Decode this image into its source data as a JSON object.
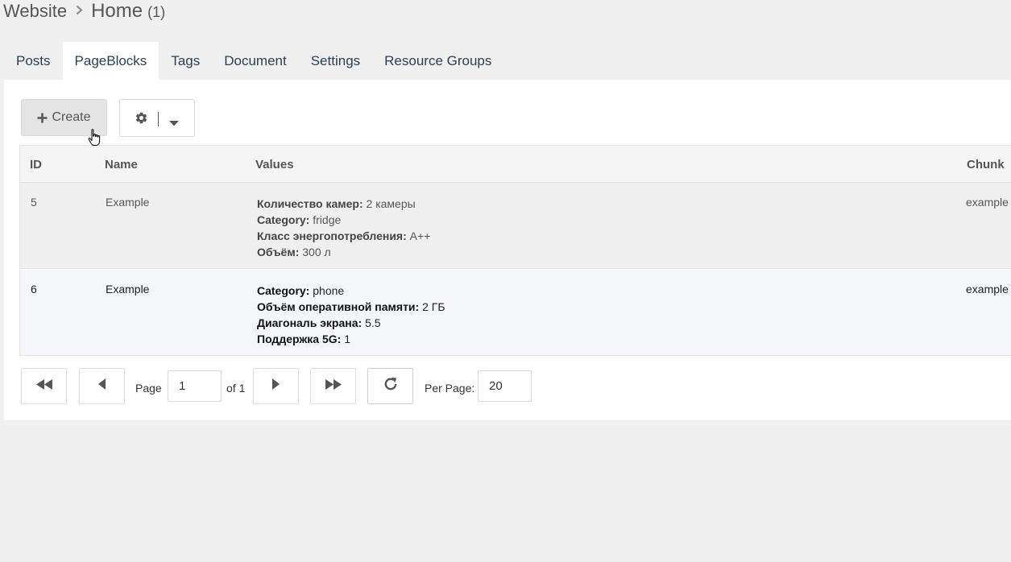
{
  "breadcrumb": {
    "parent": "Website",
    "current": "Home",
    "count": "(1)"
  },
  "tabs": [
    {
      "label": "Posts",
      "active": false
    },
    {
      "label": "PageBlocks",
      "active": true
    },
    {
      "label": "Tags",
      "active": false
    },
    {
      "label": "Document",
      "active": false
    },
    {
      "label": "Settings",
      "active": false
    },
    {
      "label": "Resource Groups",
      "active": false
    }
  ],
  "toolbar": {
    "create_label": "Create",
    "create_icon": "plus-icon",
    "settings_icon": "gear-icon",
    "menu_icon": "caret-down-icon"
  },
  "grid": {
    "columns": {
      "id": "ID",
      "name": "Name",
      "values": "Values",
      "chunk": "Chunk"
    },
    "rows": [
      {
        "id": "5",
        "name": "Example",
        "chunk": "example",
        "values": [
          {
            "key": "Количество камер:",
            "value": "2 камеры"
          },
          {
            "key": "Category:",
            "value": "fridge"
          },
          {
            "key": "Класс энергопотребления:",
            "value": "A++"
          },
          {
            "key": "Объём:",
            "value": "300 л"
          }
        ]
      },
      {
        "id": "6",
        "name": "Example",
        "chunk": "example",
        "values": [
          {
            "key": "Category:",
            "value": "phone"
          },
          {
            "key": "Объём оперативной памяти:",
            "value": "2 ГБ"
          },
          {
            "key": "Диагональ экрана:",
            "value": "5.5"
          },
          {
            "key": "Поддержка 5G:",
            "value": "1"
          }
        ]
      }
    ]
  },
  "pager": {
    "page_label": "Page",
    "page_value": "1",
    "of_label": "of 1",
    "per_page_label": "Per Page:",
    "per_page_value": "20",
    "icons": {
      "first": "first-page-icon",
      "prev": "previous-page-icon",
      "next": "next-page-icon",
      "last": "last-page-icon",
      "refresh": "refresh-icon"
    }
  },
  "colors": {
    "background": "#f0f0f0",
    "panel": "#ffffff",
    "tab_text": "#2e3e52",
    "text": "#555555"
  }
}
